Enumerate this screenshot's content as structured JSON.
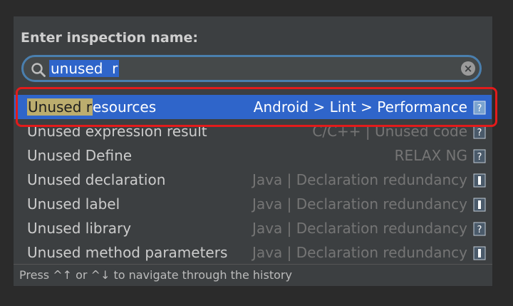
{
  "dialog": {
    "title": "Enter inspection name:",
    "search_value": "unused  r"
  },
  "results": [
    {
      "name_highlight": "Unused r",
      "name_rest": "esources",
      "category": "Android > Lint > Performance",
      "icon": "help-doc-icon",
      "selected": true
    },
    {
      "name_highlight": "",
      "name_rest": "Unused expression result",
      "category": "C/C++ | Unused code",
      "icon": "help-doc-icon"
    },
    {
      "name_highlight": "",
      "name_rest": "Unused Define",
      "category": "RELAX NG",
      "icon": "help-doc-icon"
    },
    {
      "name_highlight": "",
      "name_rest": "Unused declaration",
      "category": "Java | Declaration redundancy",
      "icon": "java-doc-icon"
    },
    {
      "name_highlight": "",
      "name_rest": "Unused label",
      "category": "Java | Declaration redundancy",
      "icon": "java-doc-icon"
    },
    {
      "name_highlight": "",
      "name_rest": "Unused library",
      "category": "Java | Declaration redundancy",
      "icon": "help-doc-icon"
    },
    {
      "name_highlight": "",
      "name_rest": "Unused method parameters",
      "category": "Java | Declaration redundancy",
      "icon": "java-doc-icon"
    }
  ],
  "footer": {
    "hint": "Press ^↑ or ^↓ to navigate through the history"
  },
  "colors": {
    "selection": "#2f65ca",
    "match_highlight": "#bcad6e",
    "annotation_frame": "#e21b1b"
  }
}
